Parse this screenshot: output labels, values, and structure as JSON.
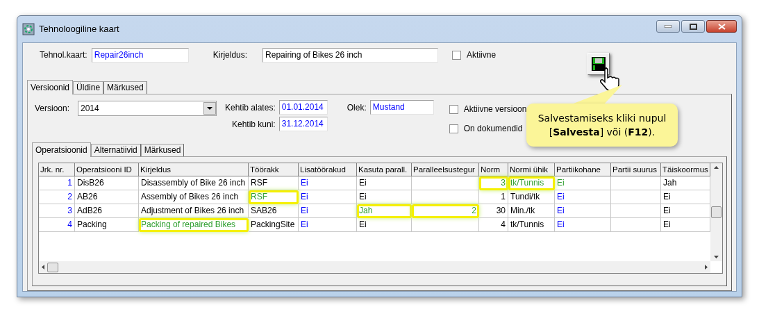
{
  "window": {
    "title": "Tehnoloogiline kaart"
  },
  "header": {
    "card_label": "Tehnol.kaart:",
    "card_value": "Repair26inch",
    "description_label": "Kirjeldus:",
    "description_value": "Repairing of Bikes 26 inch",
    "active": {
      "label": "Aktiivne",
      "checked": false
    }
  },
  "tooltip": {
    "text": "Salvestamiseks kliki nupul [**Salvesta**] või (**F12**)."
  },
  "tabs": [
    {
      "label": "Versioonid",
      "selected": true
    },
    {
      "label": "Üldine",
      "selected": false
    },
    {
      "label": "Märkused",
      "selected": false
    }
  ],
  "version": {
    "version_label": "Versioon:",
    "version_value": "2014",
    "valid_from_label": "Kehtib alates:",
    "valid_from": "01.01.2014",
    "valid_to_label": "Kehtib kuni:",
    "valid_to": "31.12.2014",
    "status_label": "Olek:",
    "status": "Mustand",
    "checkboxes": [
      {
        "label": "Aktiivne versioon",
        "checked": false
      },
      {
        "label": "On dokumendid",
        "checked": false
      }
    ]
  },
  "inner_tabs": [
    {
      "label": "Operatsioonid",
      "selected": true
    },
    {
      "label": "Alternatiivid",
      "selected": false
    },
    {
      "label": "Märkused",
      "selected": false
    }
  ],
  "table": {
    "columns": [
      {
        "label": "Jrk. nr."
      },
      {
        "label": "Operatsiooni ID"
      },
      {
        "label": "Kirjeldus"
      },
      {
        "label": "Töörakk"
      },
      {
        "label": "Lisatöörakud"
      },
      {
        "label": "Kasuta parall."
      },
      {
        "label": "Paralleelsustegur"
      },
      {
        "label": "Norm"
      },
      {
        "label": "Normi ühik"
      },
      {
        "label": "Partiikohane"
      },
      {
        "label": "Partii suurus"
      },
      {
        "label": "Täiskoormus"
      }
    ],
    "rows": [
      [
        {
          "text": "1",
          "color": "#0000ff",
          "highlighted": false
        },
        {
          "text": "DisB26",
          "color": "#000000",
          "highlighted": false
        },
        {
          "text": "Disassembly of Bike 26 inch",
          "color": "#000000",
          "highlighted": false
        },
        {
          "text": "RSF",
          "color": "#000000",
          "highlighted": false
        },
        {
          "text": "Ei",
          "color": "#0000ff",
          "highlighted": false
        },
        {
          "text": "Ei",
          "color": "#000000",
          "highlighted": false
        },
        null,
        {
          "text": "3",
          "color": "#2e9e2e",
          "highlighted": true
        },
        {
          "text": "tk/Tunnis",
          "color": "#2e9e2e",
          "highlighted": true
        },
        {
          "text": "Ei",
          "color": "#2e9e2e",
          "highlighted": false
        },
        null,
        {
          "text": "Jah",
          "color": "#000000",
          "highlighted": false
        }
      ],
      [
        {
          "text": "2",
          "color": "#0000ff",
          "highlighted": false
        },
        {
          "text": "AB26",
          "color": "#000000",
          "highlighted": false
        },
        {
          "text": "Assembly of Bikes 26 inch",
          "color": "#000000",
          "highlighted": false
        },
        {
          "text": "RSF",
          "color": "#2e9e2e",
          "highlighted": true
        },
        {
          "text": "Ei",
          "color": "#0000ff",
          "highlighted": false
        },
        {
          "text": "Ei",
          "color": "#000000",
          "highlighted": false
        },
        null,
        {
          "text": "1",
          "color": "#000000",
          "highlighted": false
        },
        {
          "text": "Tundi/tk",
          "color": "#000000",
          "highlighted": false
        },
        {
          "text": "Ei",
          "color": "#0000ff",
          "highlighted": false
        },
        null,
        {
          "text": "Ei",
          "color": "#000000",
          "highlighted": false
        }
      ],
      [
        {
          "text": "3",
          "color": "#0000ff",
          "highlighted": false
        },
        {
          "text": "AdB26",
          "color": "#000000",
          "highlighted": false
        },
        {
          "text": "Adjustment of Bikes 26 inch",
          "color": "#000000",
          "highlighted": false
        },
        {
          "text": "SAB26",
          "color": "#000000",
          "highlighted": false
        },
        {
          "text": "Ei",
          "color": "#0000ff",
          "highlighted": false
        },
        {
          "text": "Jah",
          "color": "#2e9e2e",
          "highlighted": true
        },
        {
          "text": "2",
          "color": "#2e9e2e",
          "highlighted": true
        },
        {
          "text": "30",
          "color": "#000000",
          "highlighted": false
        },
        {
          "text": "Min./tk",
          "color": "#000000",
          "highlighted": false
        },
        {
          "text": "Ei",
          "color": "#0000ff",
          "highlighted": false
        },
        null,
        {
          "text": "Ei",
          "color": "#000000",
          "highlighted": false
        }
      ],
      [
        {
          "text": "4",
          "color": "#0000ff",
          "highlighted": false
        },
        {
          "text": "Packing",
          "color": "#000000",
          "highlighted": false
        },
        {
          "text": "Packing of repaired Bikes",
          "color": "#2e9e2e",
          "highlighted": true
        },
        {
          "text": "PackingSite",
          "color": "#000000",
          "highlighted": false
        },
        {
          "text": "Ei",
          "color": "#0000ff",
          "highlighted": false
        },
        {
          "text": "Ei",
          "color": "#000000",
          "highlighted": false
        },
        null,
        {
          "text": "4",
          "color": "#000000",
          "highlighted": false
        },
        {
          "text": "tk/Tunnis",
          "color": "#000000",
          "highlighted": false
        },
        {
          "text": "Ei",
          "color": "#0000ff",
          "highlighted": false
        },
        null,
        {
          "text": "Ei",
          "color": "#000000",
          "highlighted": false
        }
      ]
    ]
  }
}
